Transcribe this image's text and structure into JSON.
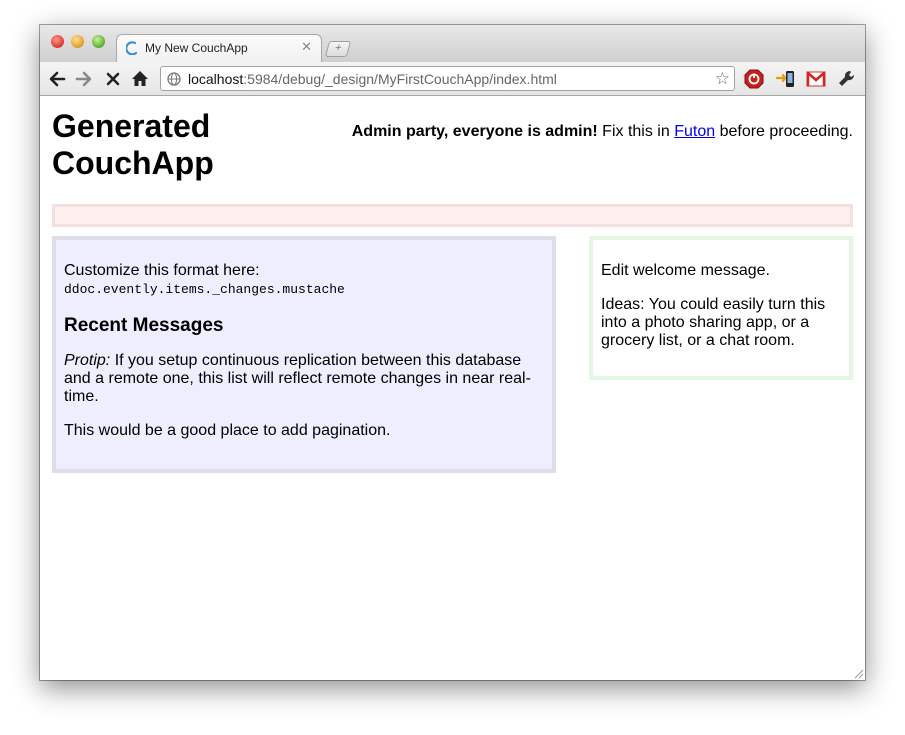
{
  "browser": {
    "tab": {
      "title": "My New CouchApp"
    },
    "omnibox": {
      "host": "localhost",
      "path": ":5984/debug/_design/MyFirstCouchApp/index.html"
    }
  },
  "page": {
    "title_line1": "Generated",
    "title_line2": "CouchApp",
    "admin": {
      "bold": "Admin party, everyone is admin!",
      "pre": " Fix this in ",
      "link": "Futon",
      "post": " before proceeding."
    },
    "main": {
      "customize_label": "Customize this format here:",
      "customize_path": "ddoc.evently.items._changes.mustache",
      "heading": "Recent Messages",
      "protip_label": "Protip:",
      "protip_text": " If you setup continuous replication between this database and a remote one, this list will reflect remote changes in near real-time.",
      "pagination_text": "This would be a good place to add pagination."
    },
    "side": {
      "welcome": "Edit welcome message.",
      "ideas": "Ideas: You could easily turn this into a photo sharing app, or a grocery list, or a chat room."
    }
  }
}
